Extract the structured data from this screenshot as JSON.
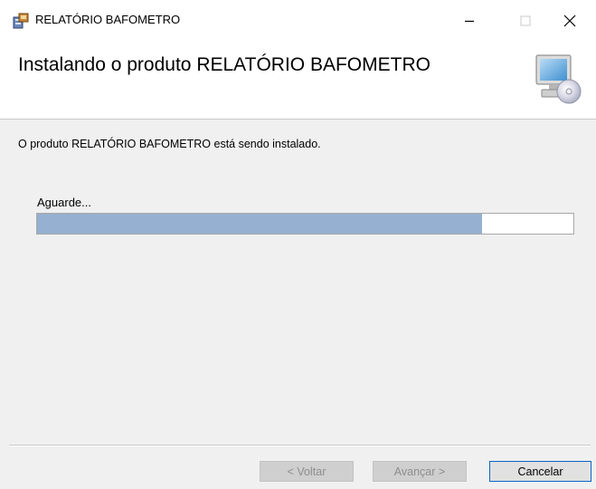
{
  "window": {
    "title": "RELATÓRIO BAFOMETRO",
    "controls": {
      "minimize": "—",
      "maximize": "☐",
      "close": "✕"
    }
  },
  "header": {
    "title": "Instalando o produto RELATÓRIO BAFOMETRO",
    "icon": "computer-cd-icon"
  },
  "body": {
    "status": "O produto RELATÓRIO BAFOMETRO está sendo instalado.",
    "progress_label": "Aguarde...",
    "progress_fraction": 0.83
  },
  "footer": {
    "back_label": "< Voltar",
    "next_label": "Avançar >",
    "cancel_label": "Cancelar"
  },
  "colors": {
    "progress_fill": "#95b0d0",
    "focus_border": "#0a64c8"
  }
}
